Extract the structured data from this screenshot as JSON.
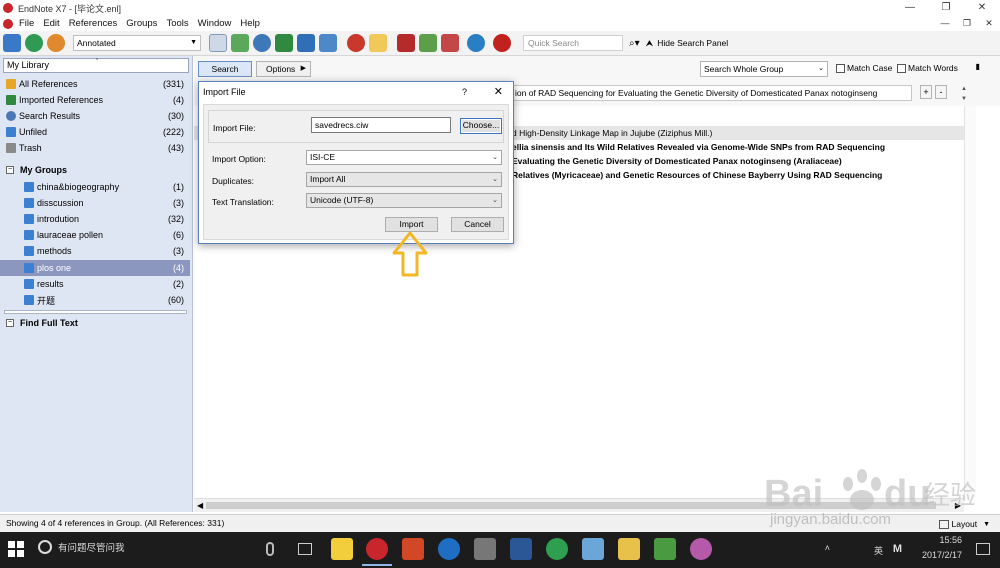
{
  "window": {
    "title": "EndNote X7 - [毕论文.enl]",
    "controls": [
      "—",
      "❐",
      "✕"
    ],
    "menu_right": [
      "—",
      "❐",
      "✕"
    ]
  },
  "menu": [
    "File",
    "Edit",
    "References",
    "Groups",
    "Tools",
    "Window",
    "Help"
  ],
  "toolbar": {
    "style": "Annotated",
    "quick_search_placeholder": "Quick Search",
    "hide_search_panel": "Hide Search Panel"
  },
  "library": {
    "selector": "My Library",
    "items": [
      {
        "label": "All References",
        "count": "(331)"
      },
      {
        "label": "Imported References",
        "count": "(4)"
      },
      {
        "label": "Search Results",
        "count": "(30)"
      },
      {
        "label": "Unfiled",
        "count": "(222)"
      },
      {
        "label": "Trash",
        "count": "(43)"
      }
    ],
    "groups_header": "My Groups",
    "groups": [
      {
        "label": "china&biogeography",
        "count": "(1)"
      },
      {
        "label": "disscussion",
        "count": "(3)"
      },
      {
        "label": "introdution",
        "count": "(32)"
      },
      {
        "label": "lauraceae pollen",
        "count": "(6)"
      },
      {
        "label": "methods",
        "count": "(3)"
      },
      {
        "label": "plos one",
        "count": "(4)"
      },
      {
        "label": "results",
        "count": "(2)"
      },
      {
        "label": "开题",
        "count": "(60)"
      }
    ],
    "find_full_text": "Find Full Text"
  },
  "search": {
    "search_button": "Search",
    "options_button": "Options",
    "scope": "Search Whole Group",
    "match_case": "Match Case",
    "match_words": "Match Words",
    "field_text": "ion of RAD Sequencing for Evaluating the Genetic Diversity of Domesticated Panax notoginseng",
    "plus": "+",
    "minus": "-"
  },
  "references": {
    "rows": [
      "d High-Density Linkage Map in Jujube (Ziziphus Mill.)",
      "ellia sinensis and Its Wild Relatives Revealed via Genome-Wide SNPs from RAD Sequencing",
      "Evaluating the Genetic Diversity of Domesticated Panax notoginseng (Araliaceae)",
      "Relatives (Myricaceae) and Genetic Resources of Chinese Bayberry Using RAD Sequencing"
    ]
  },
  "status": {
    "text": "Showing 4 of 4 references in Group. (All References: 331)",
    "layout": "Layout"
  },
  "dialog": {
    "title": "Import File",
    "help": "?",
    "close": "✕",
    "import_file_label": "Import File:",
    "file_value": "savedrecs.ciw",
    "choose_button": "Choose...",
    "import_option_label": "Import Option:",
    "import_option_value": "ISI-CE",
    "duplicates_label": "Duplicates:",
    "duplicates_value": "Import All",
    "translation_label": "Text Translation:",
    "translation_value": "Unicode (UTF-8)",
    "import_button": "Import",
    "cancel_button": "Cancel"
  },
  "taskbar": {
    "cortana": "有问题尽管问我",
    "ime": "英",
    "ime2": "M",
    "time": "15:56",
    "date": "2017/2/17"
  },
  "watermark": {
    "line1": "Bai",
    "line2": "du",
    "line3": "经验",
    "url": "jingyan.baidu.com"
  },
  "colors": {
    "accent": "#3d7fd0",
    "selected": "#8c97bf",
    "arrow": "#f2b824",
    "brand": "#c8252c"
  }
}
